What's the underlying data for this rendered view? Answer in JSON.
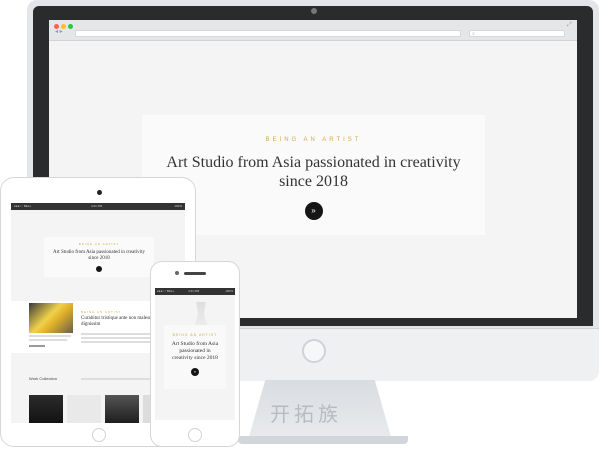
{
  "hero": {
    "eyebrow": "BEING AN ARTIST",
    "title_line1": "Art Studio from Asia passionated in creativity",
    "title_line2": "since 2018"
  },
  "phone_hero": {
    "title_line1": "Art Studio from Asia",
    "title_line2": "passionated in",
    "title_line3": "creativity since 2018"
  },
  "status_bar": {
    "carrier": "●●●○○ BELL",
    "time": "4:21 PM",
    "battery": "100%"
  },
  "tablet_section": {
    "heading_line1": "Curabitur tristique ante non malesuada",
    "heading_line2": "dignissim",
    "work_title": "Work Collection"
  },
  "watermark": "开拓族",
  "colors": {
    "accent": "#d4a94a",
    "screen_bg": "#f4f4f4",
    "dark": "#151515"
  },
  "icons": {
    "scroll_down": "chevron-down-icon"
  }
}
